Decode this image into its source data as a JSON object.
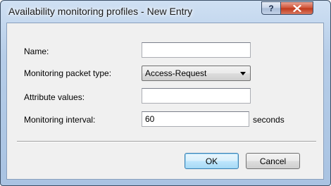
{
  "window": {
    "title": "Availability monitoring profiles - New Entry"
  },
  "titlebar_buttons": {
    "help_label": "?",
    "close_icon": "close-x-icon"
  },
  "form": {
    "name": {
      "label": "Name:",
      "value": ""
    },
    "packet_type": {
      "label": "Monitoring packet type:",
      "selected": "Access-Request"
    },
    "attribute_values": {
      "label": "Attribute values:",
      "value": ""
    },
    "interval": {
      "label": "Monitoring interval:",
      "value": "60",
      "unit": "seconds"
    }
  },
  "buttons": {
    "ok_label": "OK",
    "cancel_label": "Cancel"
  },
  "colors": {
    "title_bar": "#b6cde8",
    "close_button": "#c0391b",
    "default_button_border": "#3c7fb1"
  }
}
